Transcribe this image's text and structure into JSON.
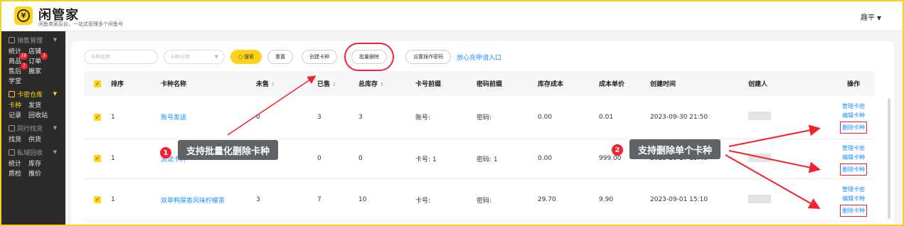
{
  "app": {
    "title": "闲管家",
    "subtitle": "闲鱼商家后台，一站式管理多个闲鱼号",
    "user": "趣平"
  },
  "sidebar": {
    "sales": {
      "title": "销售管理",
      "row1": [
        "统计",
        "店铺"
      ],
      "row2": [
        "商品",
        "订单"
      ],
      "badge_goods": "16",
      "badge_orders": "3",
      "row3": [
        "售后",
        "搬家"
      ],
      "badge_after": "1",
      "row4": [
        "学堂"
      ]
    },
    "cardlib": {
      "title": "卡密仓库",
      "row1": [
        "卡种",
        "发货"
      ],
      "row2": [
        "记录",
        "回收站"
      ]
    },
    "peers": {
      "title": "同行找货",
      "row1": [
        "找货",
        "供货"
      ]
    },
    "recycle": {
      "title": "私域回收",
      "row1": [
        "统计",
        "库存"
      ],
      "row2": [
        "质检",
        "推价"
      ]
    }
  },
  "filters": {
    "name_placeholder": "卡种名称",
    "category_placeholder": "卡种分类",
    "search": "搜索",
    "reset": "重置",
    "create": "创建卡种",
    "batch_delete": "批量删除",
    "set_password": "设置操作密码",
    "apply_link": "放心充申请入口"
  },
  "table": {
    "headers": [
      "排序",
      "卡种名称",
      "未售",
      "已售",
      "总库存",
      "卡号前缀",
      "密码前缀",
      "库存成本",
      "成本单价",
      "创建时间",
      "创建人",
      "操作"
    ],
    "rows": [
      {
        "sort": "1",
        "name": "账号发送",
        "unsold": "0",
        "sold": "3",
        "total": "3",
        "card_prefix": "账号:",
        "pwd_prefix": "密码:",
        "stock_cost": "0.00",
        "unit_cost": "0.01",
        "created": "2023-09-30 21:50"
      },
      {
        "sort": "1",
        "name": "测试卡种",
        "unsold": "0",
        "sold": "0",
        "total": "0",
        "card_prefix": "卡号: 1",
        "pwd_prefix": "密码: 1",
        "stock_cost": "0.00",
        "unit_cost": "999.00",
        "created": "2023-10-17 15:49"
      },
      {
        "sort": "1",
        "name": "双萃鸭屎香风味柠檬茶",
        "unsold": "3",
        "sold": "7",
        "total": "10",
        "card_prefix": "卡号:",
        "pwd_prefix": "密码:",
        "stock_cost": "29.70",
        "unit_cost": "9.90",
        "created": "2023-09-01 15:10"
      }
    ],
    "ops": [
      "管理卡密",
      "编辑卡种",
      "删除卡种"
    ]
  },
  "annotations": {
    "num1": "1",
    "tip1": "支持批量化删除卡种",
    "num2": "2",
    "tip2": "支持删除单个卡种"
  },
  "colors": {
    "accent": "#ffd319",
    "link": "#1890ff",
    "annotation": "#f5222d"
  }
}
